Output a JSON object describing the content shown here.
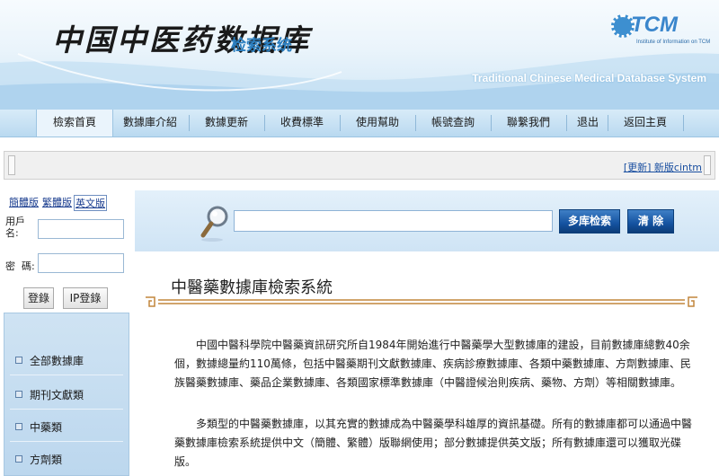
{
  "header": {
    "logo_cn": "中国中医药数据库",
    "logo_sub": "检索系统",
    "tcm_badge": "TCM",
    "tcm_badge_small": "Institute of Information on TCM",
    "title_en": "Traditional Chinese Medical Database System"
  },
  "nav": {
    "items": [
      {
        "label": "檢索首頁",
        "active": true
      },
      {
        "label": "數據庫介紹"
      },
      {
        "label": "數據更新"
      },
      {
        "label": "收費標準"
      },
      {
        "label": "使用幫助"
      },
      {
        "label": "帳號查詢"
      },
      {
        "label": "聯繫我們"
      },
      {
        "label": "退出"
      },
      {
        "label": "返回主頁"
      }
    ]
  },
  "infobar": {
    "update_link": "[更新] 新版cintm"
  },
  "sidebar": {
    "lang_links": [
      "簡體版",
      "繁體版",
      "英文版"
    ],
    "username_label": "用戶名:",
    "password_label": "密  碼:",
    "login_button": "登錄",
    "ip_login_button": "IP登錄",
    "db_items": [
      "全部數據庫",
      "期刊文獻類",
      "中藥類",
      "方劑類"
    ]
  },
  "search": {
    "multi_db_button": "多库检索",
    "clear_button": "清  除"
  },
  "main": {
    "title": "中醫藥數據庫檢索系統",
    "paragraphs": [
      "中國中醫科學院中醫藥資訊研究所自1984年開始進行中醫藥學大型數據庫的建設，目前數據庫總數40余個，數據總量約110萬條，包括中醫藥期刊文獻數據庫、疾病診療數據庫、各類中藥數據庫、方劑數據庫、民族醫藥數據庫、藥品企業數據庫、各類國家標準數據庫（中醫證候治則疾病、藥物、方劑）等相關數據庫。",
      "多類型的中醫藥數據庫，以其充實的數據成為中醫藥學科雄厚的資訊基礎。所有的數據庫都可以通過中醫藥數據庫檢索系統提供中文（簡體、繁體）版聯網使用；部分數據提供英文版；所有數據庫還可以獲取光碟版。"
    ]
  }
}
